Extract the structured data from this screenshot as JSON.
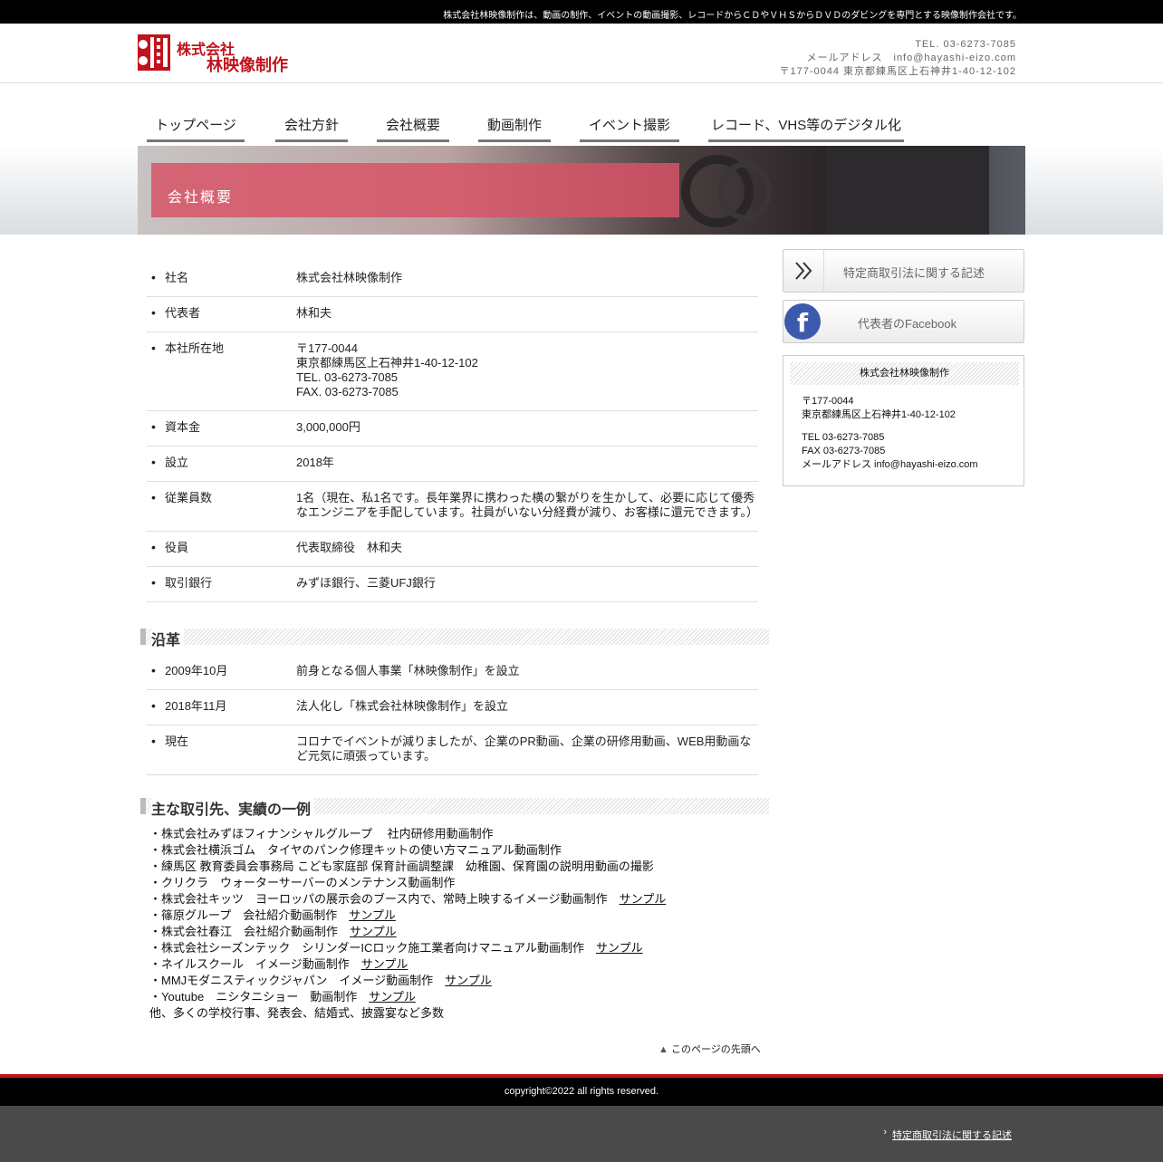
{
  "topbar": {
    "text": "株式会社林映像制作は、動画の制作、イベントの動画撮影、レコードからＣＤやＶＨＳからＤＶＤのダビングを専門とする映像制作会社です。"
  },
  "header": {
    "logo_line1": "株式会社",
    "logo_line2": "林映像制作",
    "tel": "TEL. 03-6273-7085",
    "mail": "メールアドレス　info@hayashi-eizo.com",
    "address": "〒177-0044 東京都練馬区上石神井1-40-12-102"
  },
  "nav": {
    "items": [
      "トップページ",
      "会社方針",
      "会社概要",
      "動画制作",
      "イベント撮影",
      "レコード、VHS等のデジタル化"
    ]
  },
  "hero": {
    "title": "会社概要"
  },
  "profile": {
    "rows": [
      {
        "key": "社名",
        "value": "株式会社林映像制作"
      },
      {
        "key": "代表者",
        "value": "林和夫"
      },
      {
        "key": "本社所在地",
        "value": "〒177-0044\n東京都練馬区上石神井1-40-12-102\nTEL. 03-6273-7085\nFAX. 03-6273-7085"
      },
      {
        "key": "資本金",
        "value": "3,000,000円"
      },
      {
        "key": "設立",
        "value": "2018年"
      },
      {
        "key": "従業員数",
        "value": "1名（現在、私1名です。長年業界に携わった横の繋がりを生かして、必要に応じて優秀なエンジニアを手配しています。社員がいない分経費が減り、お客様に還元できます。）"
      },
      {
        "key": "役員",
        "value": "代表取締役　林和夫"
      },
      {
        "key": "取引銀行",
        "value": "みずほ銀行、三菱UFJ銀行"
      }
    ]
  },
  "history": {
    "heading": "沿革",
    "rows": [
      {
        "key": "2009年10月",
        "value": "前身となる個人事業「林映像制作」を設立"
      },
      {
        "key": "2018年11月",
        "value": "法人化し「株式会社林映像制作」を設立"
      },
      {
        "key": "現在",
        "value": "コロナでイベントが減りましたが、企業のPR動画、企業の研修用動画、WEB用動画など元気に頑張っています。"
      }
    ]
  },
  "clients": {
    "heading": "主な取引先、実績の一例",
    "sample_label": "サンプル",
    "items": [
      {
        "text": "・株式会社みずほフィナンシャルグループ　 社内研修用動画制作",
        "sample": false
      },
      {
        "text": "・株式会社横浜ゴム　タイヤのパンク修理キットの使い方マニュアル動画制作",
        "sample": false
      },
      {
        "text": "・練馬区 教育委員会事務局 こども家庭部 保育計画調整課　幼稚園、保育園の説明用動画の撮影",
        "sample": false
      },
      {
        "text": "・クリクラ　ウォーターサーバーのメンテナンス動画制作",
        "sample": false
      },
      {
        "text": "・株式会社キッツ　ヨーロッパの展示会のブース内で、常時上映するイメージ動画制作　",
        "sample": true
      },
      {
        "text": "・篠原グループ　会社紹介動画制作　",
        "sample": true
      },
      {
        "text": "・株式会社春江　会社紹介動画制作　",
        "sample": true
      },
      {
        "text": "・株式会社シーズンテック　シリンダーICロック施工業者向けマニュアル動画制作　",
        "sample": true
      },
      {
        "text": "・ネイルスクール　イメージ動画制作　",
        "sample": true
      },
      {
        "text": "・MMJモダニスティックジャパン　イメージ動画制作　",
        "sample": true
      },
      {
        "text": "・Youtube　ニシタニショー　動画制作　",
        "sample": true
      },
      {
        "text": "他、多くの学校行事、発表会、結婚式、披露宴など多数",
        "sample": false
      }
    ]
  },
  "pagetop": {
    "label": "このページの先頭へ"
  },
  "sidebar": {
    "btn1": "特定商取引法に関する記述",
    "btn2": "代表者のFacebook",
    "card_title": "株式会社林映像制作",
    "card_postal": "〒177-0044",
    "card_address": "東京都練馬区上石神井1-40-12-102",
    "card_tel": "TEL 03-6273-7085",
    "card_fax": "FAX 03-6273-7085",
    "card_mail": "メールアドレス info@hayashi-eizo.com"
  },
  "footer": {
    "copyright": "copyright©2022  all rights reserved.",
    "link": "特定商取引法に関する記述"
  },
  "colors": {
    "brand_red": "#c0131c",
    "hero_pink": "#d75366",
    "facebook_blue": "#3b5aab"
  },
  "icons": {
    "sidebar_btn1": "double-chevron-right-icon",
    "sidebar_btn2": "facebook-icon",
    "pagetop": "triangle-up-icon"
  }
}
